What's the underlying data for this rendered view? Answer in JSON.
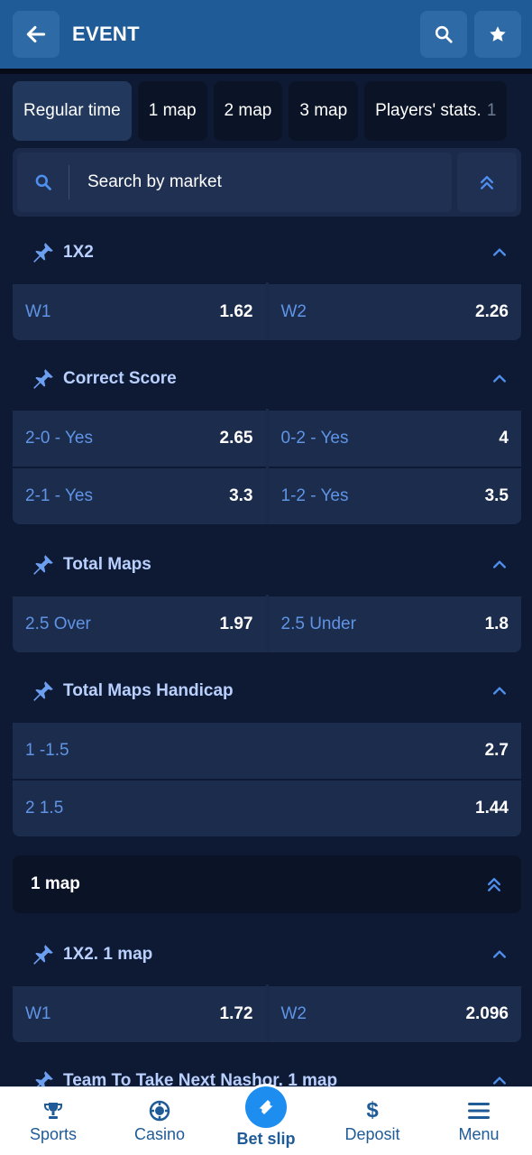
{
  "header": {
    "title": "EVENT"
  },
  "tabs": [
    {
      "label": "Regular time"
    },
    {
      "label": "1 map"
    },
    {
      "label": "2 map"
    },
    {
      "label": "3 map"
    },
    {
      "label": "Players' stats.",
      "suffix": "1"
    }
  ],
  "search": {
    "placeholder": "Search by market"
  },
  "markets": [
    {
      "title": "1X2",
      "rows": [
        [
          {
            "label": "W1",
            "odd": "1.62"
          },
          {
            "label": "W2",
            "odd": "2.26"
          }
        ]
      ]
    },
    {
      "title": "Correct Score",
      "rows": [
        [
          {
            "label": "2-0 - Yes",
            "odd": "2.65"
          },
          {
            "label": "0-2 - Yes",
            "odd": "4"
          }
        ],
        [
          {
            "label": "2-1 - Yes",
            "odd": "3.3"
          },
          {
            "label": "1-2 - Yes",
            "odd": "3.5"
          }
        ]
      ]
    },
    {
      "title": "Total Maps",
      "rows": [
        [
          {
            "label": "2.5 Over",
            "odd": "1.97"
          },
          {
            "label": "2.5 Under",
            "odd": "1.8"
          }
        ]
      ]
    },
    {
      "title": "Total Maps Handicap",
      "rows": [
        [
          {
            "label": "1 -1.5",
            "odd": "2.7"
          }
        ],
        [
          {
            "label": "2 1.5",
            "odd": "1.44"
          }
        ]
      ]
    }
  ],
  "section": {
    "title": "1 map"
  },
  "markets_map1": [
    {
      "title": "1X2. 1 map",
      "rows": [
        [
          {
            "label": "W1",
            "odd": "1.72"
          },
          {
            "label": "W2",
            "odd": "2.096"
          }
        ]
      ]
    },
    {
      "title": "Team To Take Next Nashor. 1 map"
    }
  ],
  "nav": {
    "sports": "Sports",
    "casino": "Casino",
    "betslip": "Bet slip",
    "deposit": "Deposit",
    "menu": "Menu"
  },
  "colors": {
    "header": "#1f5b97",
    "accent": "#1d8ef0",
    "odd_label": "#5f94e6",
    "market_title": "#b9d0ff"
  }
}
